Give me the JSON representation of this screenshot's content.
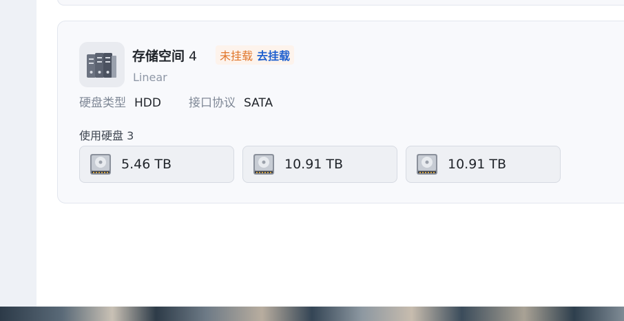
{
  "volume": {
    "title": "存储空间",
    "number": "4",
    "status": "未挂载",
    "action": "去挂载",
    "raid_type": "Linear",
    "disk_type_label": "硬盘类型",
    "disk_type_value": "HDD",
    "interface_label": "接口协议",
    "interface_value": "SATA",
    "disks_label": "使用硬盘 3",
    "disks": [
      {
        "size": "5.46 TB"
      },
      {
        "size": "10.91 TB"
      },
      {
        "size": "10.91 TB"
      }
    ]
  },
  "colors": {
    "status": "#e0762b",
    "action": "#1d5fcf",
    "card_bg": "#f8f9fc"
  },
  "icons": {
    "volume": "server-rack-icon",
    "disk": "hdd-icon"
  }
}
